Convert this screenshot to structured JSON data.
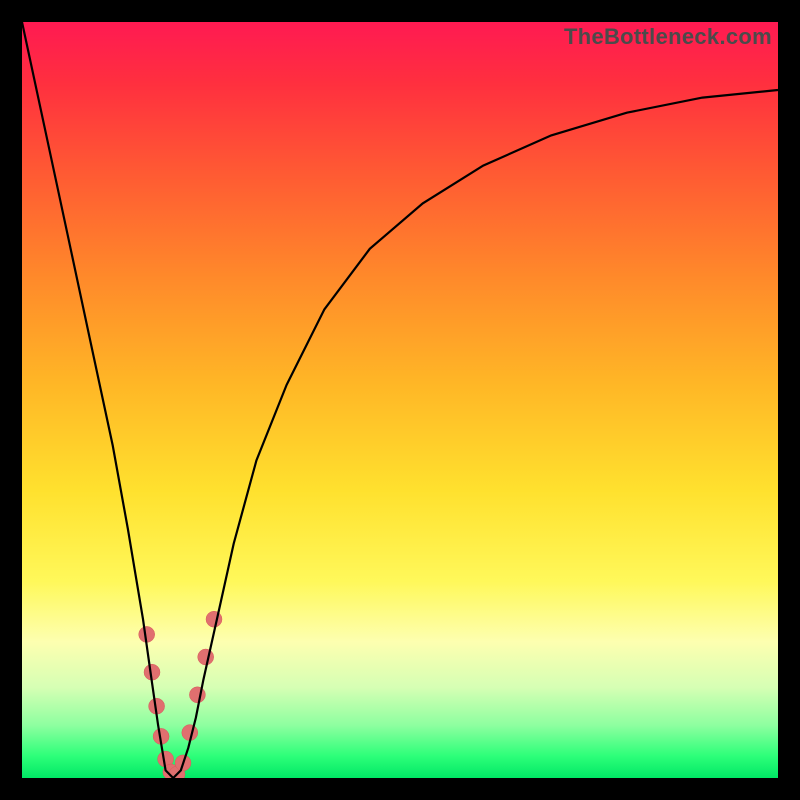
{
  "watermark": "TheBottleneck.com",
  "colors": {
    "frame": "#000000",
    "gradient_top": "#ff1a52",
    "gradient_bottom": "#00e865",
    "curve": "#000000",
    "bead": "#e06f6f"
  },
  "chart_data": {
    "type": "line",
    "title": "",
    "xlabel": "",
    "ylabel": "",
    "xlim": [
      0,
      100
    ],
    "ylim": [
      0,
      100
    ],
    "x": [
      0,
      3,
      6,
      9,
      12,
      14,
      15,
      16,
      17,
      18,
      19,
      20,
      21,
      22,
      23,
      24,
      26,
      28,
      31,
      35,
      40,
      46,
      53,
      61,
      70,
      80,
      90,
      100
    ],
    "y": [
      100,
      86,
      72,
      58,
      44,
      33,
      27,
      21,
      14,
      7,
      1,
      0,
      1,
      4,
      8,
      13,
      22,
      31,
      42,
      52,
      62,
      70,
      76,
      81,
      85,
      88,
      90,
      91
    ],
    "annotations": [],
    "grid": false,
    "legend": false,
    "beads_cluster": {
      "note": "pink dot cluster near curve minimum",
      "points": [
        {
          "x": 16.5,
          "y": 19
        },
        {
          "x": 17.2,
          "y": 14
        },
        {
          "x": 17.8,
          "y": 9.5
        },
        {
          "x": 18.4,
          "y": 5.5
        },
        {
          "x": 19.0,
          "y": 2.5
        },
        {
          "x": 19.7,
          "y": 0.8
        },
        {
          "x": 20.5,
          "y": 0.5
        },
        {
          "x": 21.3,
          "y": 2.0
        },
        {
          "x": 22.2,
          "y": 6.0
        },
        {
          "x": 23.2,
          "y": 11.0
        },
        {
          "x": 24.3,
          "y": 16.0
        },
        {
          "x": 25.4,
          "y": 21.0
        }
      ],
      "radius": 8
    }
  }
}
